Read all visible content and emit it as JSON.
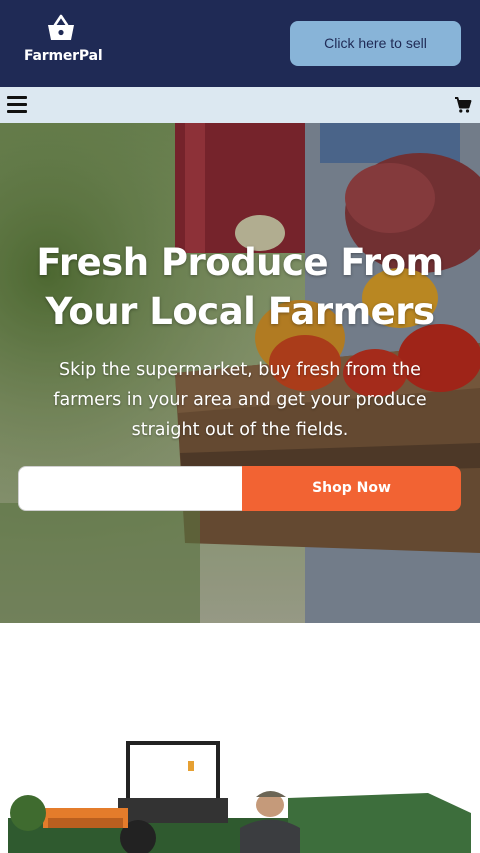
{
  "brand": {
    "name": "FarmerPal",
    "icon": "shopping-basket-icon"
  },
  "header": {
    "sell_label": "Click here to sell"
  },
  "nav": {
    "menu_icon": "hamburger-menu-icon",
    "cart_icon": "shopping-cart-icon"
  },
  "hero": {
    "title": "Fresh Produce From Your Local Farmers",
    "subtitle": "Skip the supermarket, buy fresh from the farmers in your area and get your produce straight out of the fields.",
    "search_value": "",
    "search_placeholder": "",
    "cta_label": "Shop Now",
    "cta_color": "#f26333"
  },
  "colors": {
    "topbar": "#1f2a55",
    "navbar": "#dce8f1",
    "sell_button": "#88b4d8",
    "accent": "#f26333"
  }
}
